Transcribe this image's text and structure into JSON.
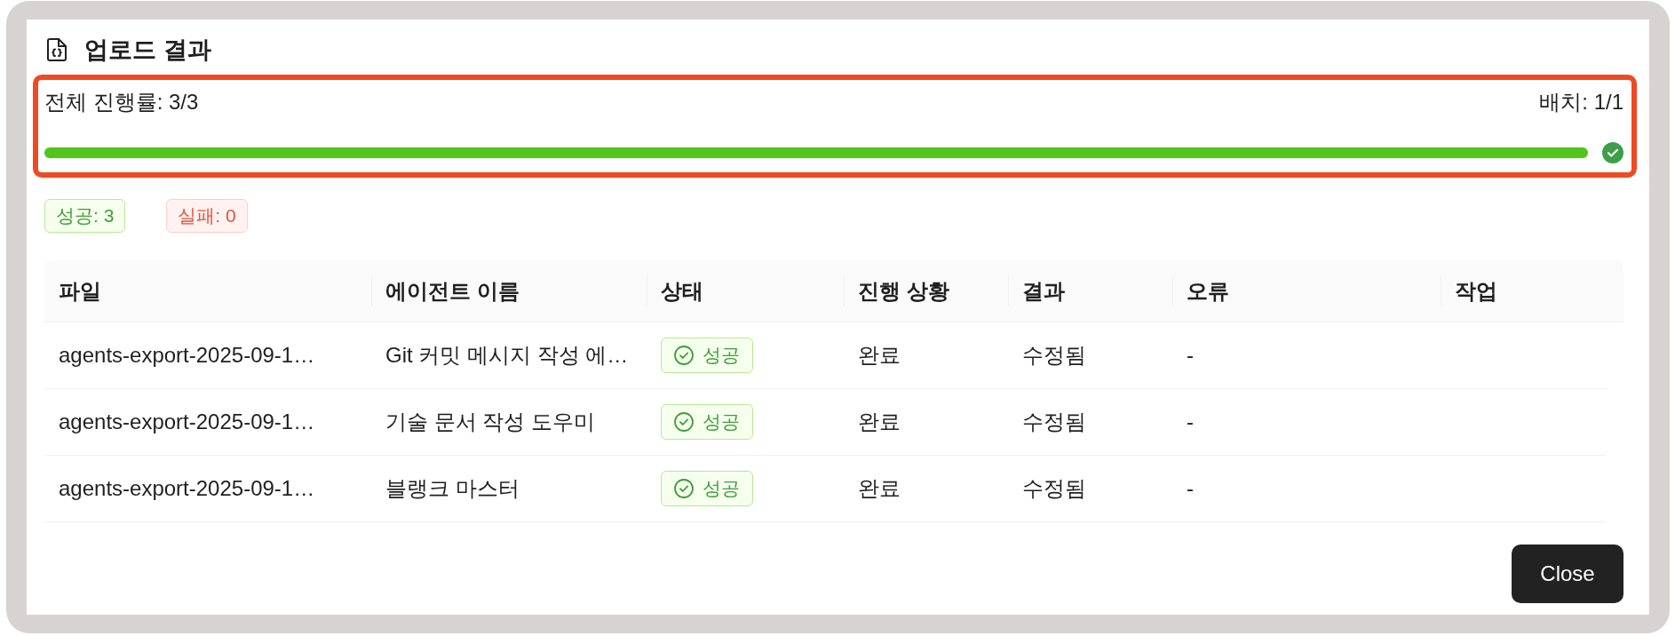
{
  "dialog": {
    "title": "업로드 결과"
  },
  "progress": {
    "label": "전체 진행률: 3/3",
    "batch": "배치: 1/1",
    "level": 1,
    "highlighted": true
  },
  "summary_tags": [
    {
      "label": "성공: 3",
      "kind": "success"
    },
    {
      "label": "실패: 0",
      "kind": "error"
    }
  ],
  "table": {
    "columns": [
      "파일",
      "에이전트 이름",
      "상태",
      "진행 상황",
      "결과",
      "오류",
      "작업"
    ],
    "rows": [
      {
        "file": "agents-export-2025-09-1…",
        "agent_name": "Git 커밋 메시지 작성 에…",
        "status": {
          "label": "성공",
          "kind": "success"
        },
        "progress": "완료",
        "result": "수정됨",
        "error": "-"
      },
      {
        "file": "agents-export-2025-09-1…",
        "agent_name": "기술 문서 작성 도우미",
        "status": {
          "label": "성공",
          "kind": "success"
        },
        "progress": "완료",
        "result": "수정됨",
        "error": "-"
      },
      {
        "file": "agents-export-2025-09-1…",
        "agent_name": "블랭크 마스터",
        "status": {
          "label": "성공",
          "kind": "success"
        },
        "progress": "완료",
        "result": "수정됨",
        "error": "-"
      }
    ]
  },
  "footer": {
    "buttons": [
      "Close"
    ]
  }
}
